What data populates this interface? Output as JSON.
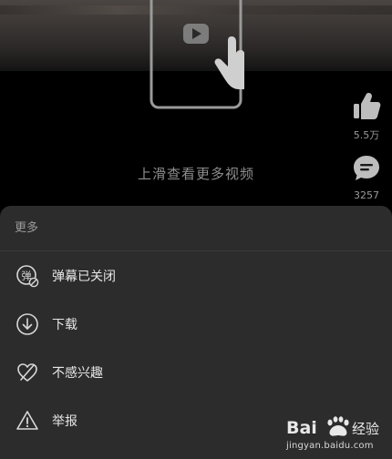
{
  "video": {
    "swipe_hint": "上滑查看更多视频",
    "like_count": "5.5万",
    "comment_count": "3257"
  },
  "sheet": {
    "title": "更多",
    "items": [
      {
        "label": "弹幕已关闭",
        "icon": "danmaku-off-icon",
        "icon_char": "弹"
      },
      {
        "label": "下载",
        "icon": "download-icon"
      },
      {
        "label": "不感兴趣",
        "icon": "not-interested-icon"
      },
      {
        "label": "举报",
        "icon": "report-icon"
      }
    ]
  },
  "watermark": {
    "brand": "Bai",
    "brand_suffix": "经验",
    "url": "jingyan.baidu.com"
  },
  "colors": {
    "sheet_bg": "#2c2c2c",
    "text_primary": "#e6e6e6",
    "text_secondary": "#9c9c9c"
  }
}
